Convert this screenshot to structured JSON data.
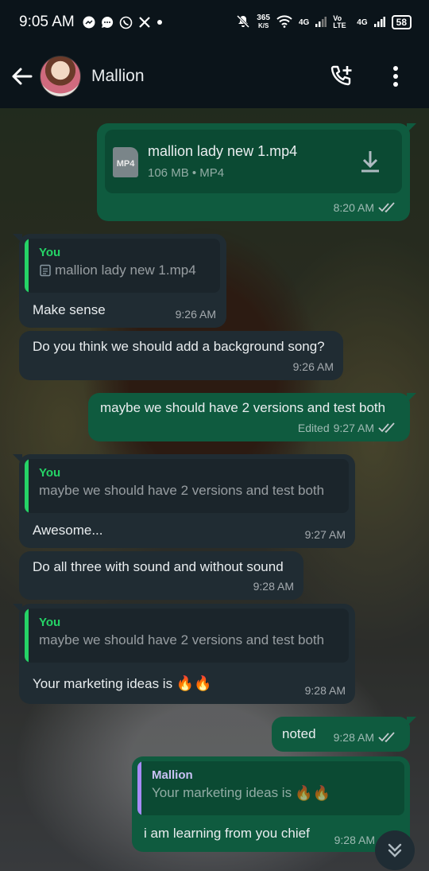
{
  "status_bar": {
    "time": "9:05 AM",
    "data_speed": "365",
    "data_unit": "K/S",
    "net1": "4G",
    "volte": "Vo LTE",
    "net2": "4G",
    "battery": "58",
    "left_icons": [
      "messenger-icon",
      "chat-icon",
      "whatsapp-icon",
      "x-icon",
      "dot-icon"
    ],
    "right_icons": [
      "mute-icon",
      "wifi-icon",
      "signal-icon"
    ]
  },
  "header": {
    "contact_name": "Mallion",
    "actions": [
      "add-call-icon",
      "more-icon"
    ]
  },
  "messages": {
    "m1": {
      "file_type": "MP4",
      "file_name": "mallion lady new  1.mp4",
      "file_meta": "106 MB • MP4",
      "time": "8:20 AM"
    },
    "m2": {
      "quote_author": "You",
      "quote_text": "mallion lady new  1.mp4",
      "text": "Make sense",
      "time": "9:26 AM"
    },
    "m3": {
      "text": "Do you think we should add a background song?",
      "time": "9:26 AM"
    },
    "m4": {
      "text": "maybe we should have 2 versions and test both",
      "edited": "Edited",
      "time": "9:27 AM"
    },
    "m5": {
      "quote_author": "You",
      "quote_text": "maybe we should have 2 versions and test both",
      "text": "Awesome...",
      "time": "9:27 AM"
    },
    "m6": {
      "text": "Do all three with sound and without sound",
      "time": "9:28 AM"
    },
    "m7": {
      "quote_author": "You",
      "quote_text": "maybe we should have 2 versions and test both",
      "text": "Your marketing ideas is",
      "emoji": "🔥🔥",
      "time": "9:28 AM"
    },
    "m8": {
      "text": "noted",
      "time": "9:28 AM"
    },
    "m9": {
      "quote_author": "Mallion",
      "quote_text": "Your marketing ideas is",
      "quote_emoji": "🔥🔥",
      "text": "i am learning from you chief",
      "time": "9:28 AM"
    }
  },
  "colors": {
    "incoming_bubble": "#202c33",
    "outgoing_bubble": "#0f5b3f",
    "accent_green": "#25d366",
    "header_bg": "#0b141a"
  }
}
